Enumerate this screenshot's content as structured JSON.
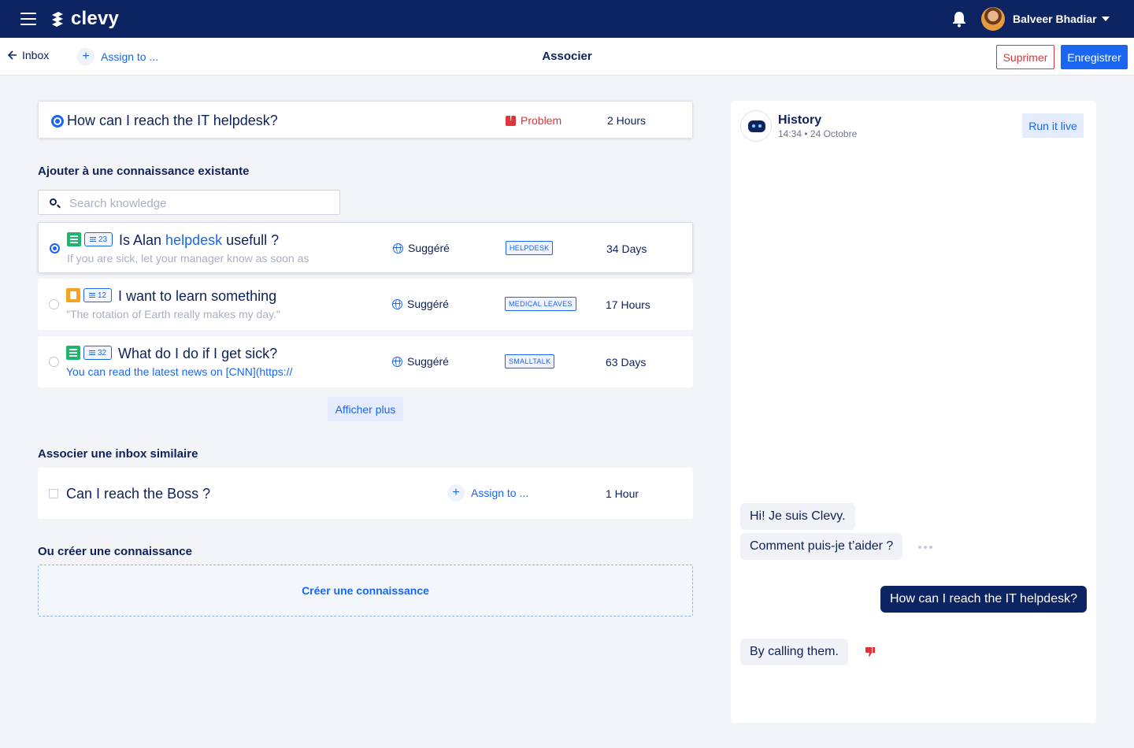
{
  "app": {
    "name": "clevy"
  },
  "user": {
    "name": "Balveer Bhadiar"
  },
  "subbar": {
    "back_label": "Inbox",
    "assign_label": "Assign to ...",
    "title": "Associer",
    "delete_label": "Suprimer",
    "save_label": "Enregistrer"
  },
  "question": {
    "title": "How can I reach the IT helpdesk?",
    "status": "Problem",
    "time": "2 Hours"
  },
  "existing": {
    "section_title": "Ajouter à une connaissance existante",
    "search_placeholder": "Search knowledge",
    "items": [
      {
        "count": "23",
        "title_before": "Is Alan ",
        "title_highlight": "helpdesk",
        "title_after": " usefull ?",
        "subtitle": "If you are sick, let your manager know as soon as",
        "lang": "Suggéré",
        "tag": "HELPDESK",
        "time": "34 Days",
        "selected": true
      },
      {
        "count": "12",
        "title": "I want to learn something",
        "subtitle": "\"The rotation of Earth really makes my day.\"",
        "lang": "Suggéré",
        "tag": "MEDICAL LEAVES",
        "time": "17 Hours",
        "selected": false
      },
      {
        "count": "32",
        "title": "What do I do if I get sick?",
        "subtitle": "You can read the latest news on [CNN](https://",
        "lang": "Suggéré",
        "tag": "SMALLTALK",
        "time": "63 Days",
        "selected": false
      }
    ],
    "more_label": "Afficher plus"
  },
  "similar": {
    "section_title": "Associer une inbox similaire",
    "item": {
      "title": "Can I reach the Boss ?",
      "assign_label": "Assign to ...",
      "time": "1 Hour"
    }
  },
  "create": {
    "section_title": "Ou créer une connaissance",
    "button_label": "Créer une connaissance"
  },
  "history": {
    "title": "History",
    "subtitle": "14:34 • 24 Octobre",
    "run_label": "Run it live",
    "messages": [
      {
        "from": "bot",
        "text": "Hi! Je suis Clevy."
      },
      {
        "from": "bot",
        "text": "Comment puis-je t’aider ?"
      },
      {
        "from": "user",
        "text": "How can I reach the IT helpdesk?"
      },
      {
        "from": "bot",
        "text": "By calling them."
      }
    ]
  },
  "colors": {
    "navy": "#0d2463",
    "accent": "#1a66f0",
    "danger": "#e0343a",
    "success": "#1eb66b",
    "warning": "#f6a323"
  }
}
